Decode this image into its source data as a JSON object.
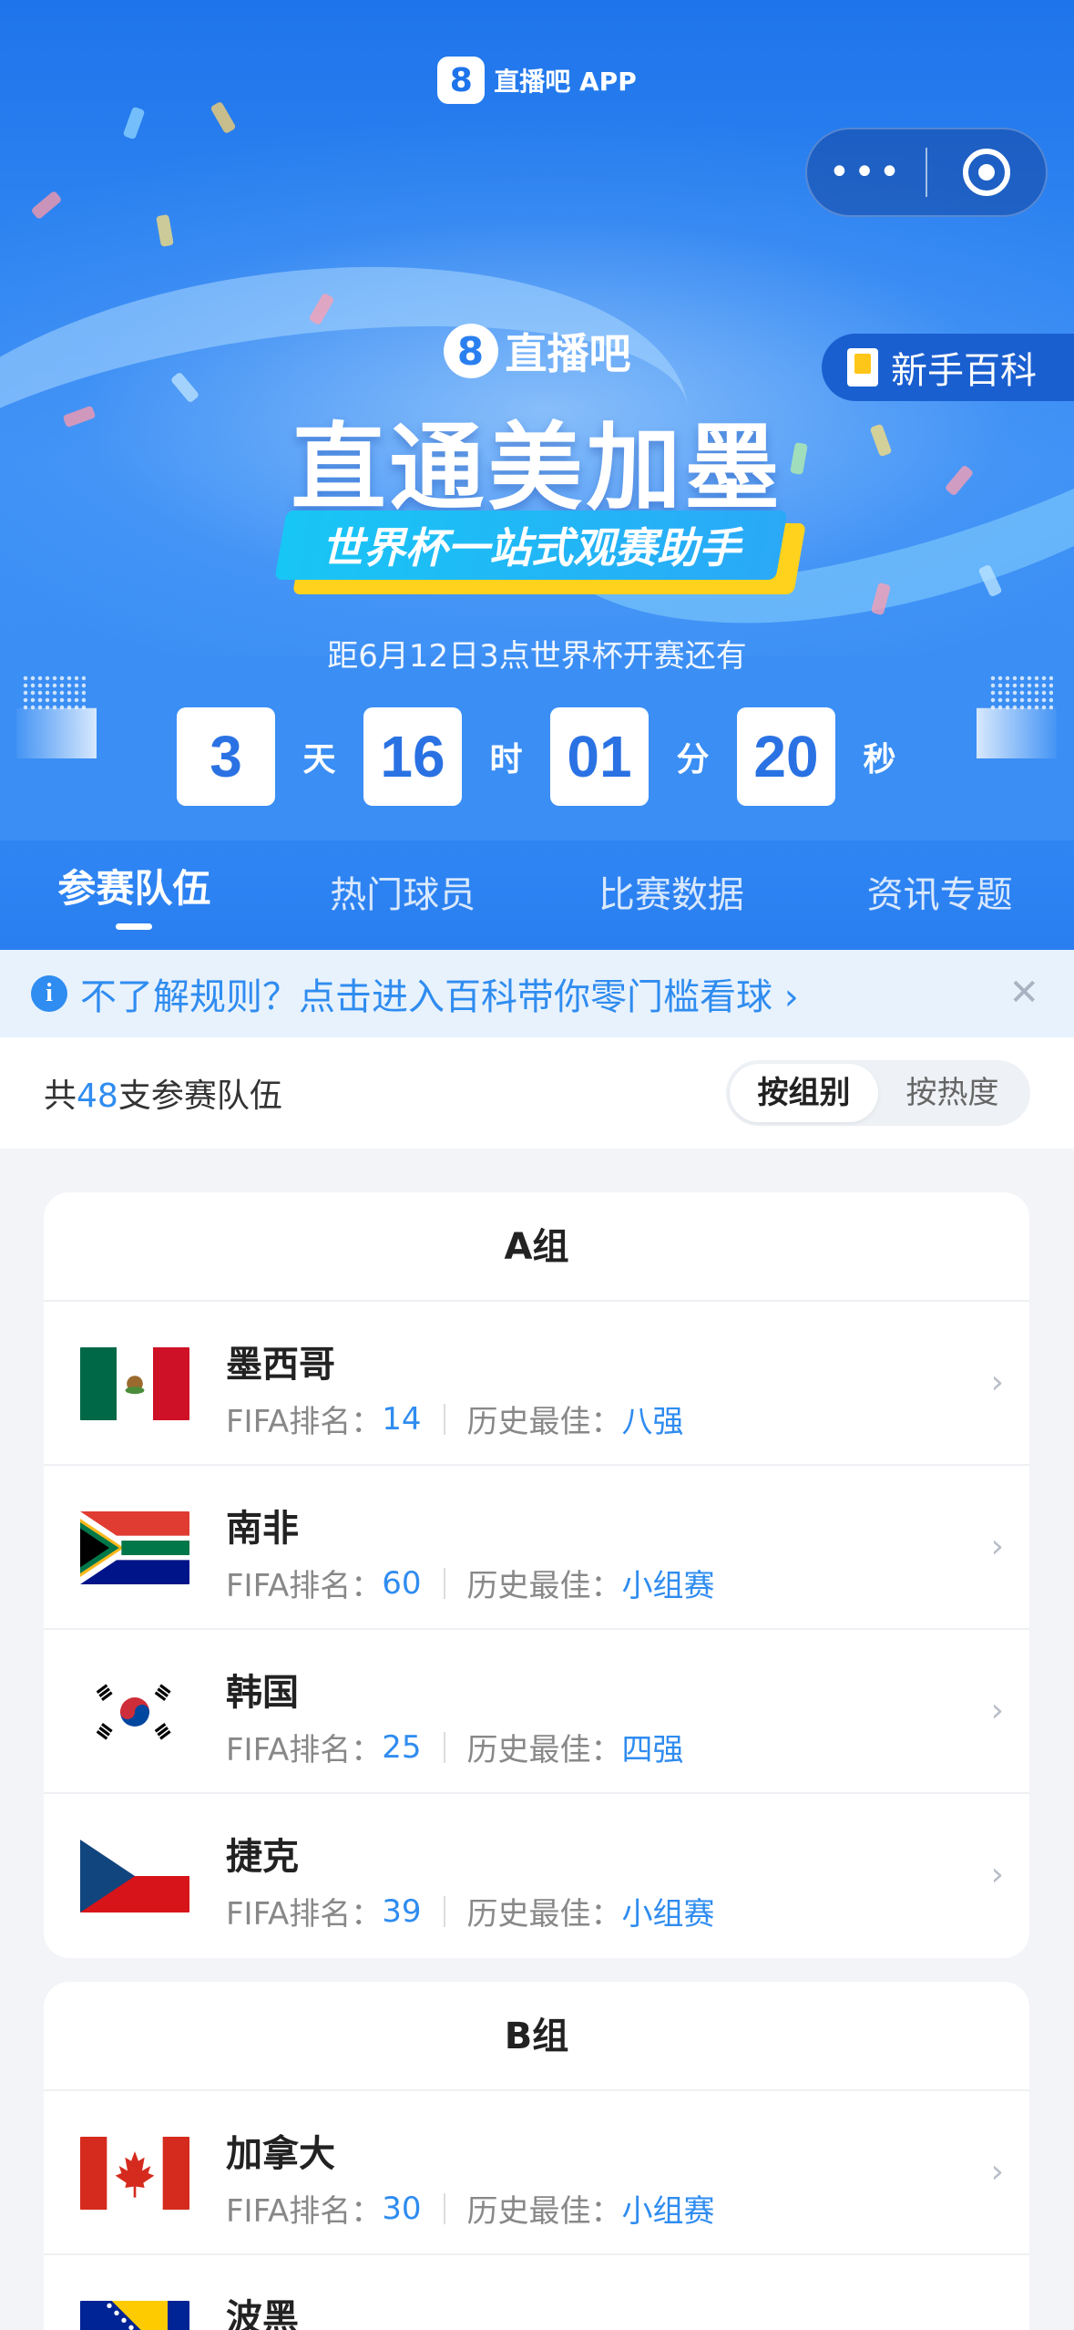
{
  "app": {
    "name": "直播吧 APP",
    "logo_glyph": "8"
  },
  "capsule": {
    "more_glyph": "•••"
  },
  "banner": {
    "brand": "直播吧",
    "headline": "直通美加墨",
    "tagline": "世界杯一站式观赛助手",
    "beginner_tag": "新手百科"
  },
  "countdown": {
    "caption": "距6月12日3点世界杯开赛还有",
    "days": "3",
    "days_unit": "天",
    "hours": "16",
    "hours_unit": "时",
    "minutes": "01",
    "minutes_unit": "分",
    "seconds": "20",
    "seconds_unit": "秒"
  },
  "tabs": [
    "参赛队伍",
    "热门球员",
    "比赛数据",
    "资讯专题"
  ],
  "active_tab": 0,
  "notice": {
    "text": "不了解规则？点击进入百科带你零门槛看球 ›",
    "close": "✕"
  },
  "filter": {
    "count_prefix": "共",
    "count": "48",
    "count_suffix": "支参赛队伍",
    "options": [
      "按组别",
      "按热度"
    ],
    "active": 0
  },
  "labels": {
    "rank": "FIFA排名：",
    "best": "历史最佳："
  },
  "groups": [
    {
      "name": "A组",
      "teams": [
        {
          "name": "墨西哥",
          "rank": "14",
          "best": "八强",
          "flag": "mexico"
        },
        {
          "name": "南非",
          "rank": "60",
          "best": "小组赛",
          "flag": "south-africa"
        },
        {
          "name": "韩国",
          "rank": "25",
          "best": "四强",
          "flag": "south-korea"
        },
        {
          "name": "捷克",
          "rank": "39",
          "best": "小组赛",
          "flag": "czechia"
        }
      ]
    },
    {
      "name": "B组",
      "teams": [
        {
          "name": "加拿大",
          "rank": "30",
          "best": "小组赛",
          "flag": "canada"
        },
        {
          "name": "波黑",
          "rank": "",
          "best": "",
          "flag": "bosnia"
        }
      ]
    }
  ],
  "colors": {
    "accent": "#2f8cf0",
    "hero": "#2c82f0",
    "number": "#2a72e3",
    "yellow": "#ffd21e"
  }
}
